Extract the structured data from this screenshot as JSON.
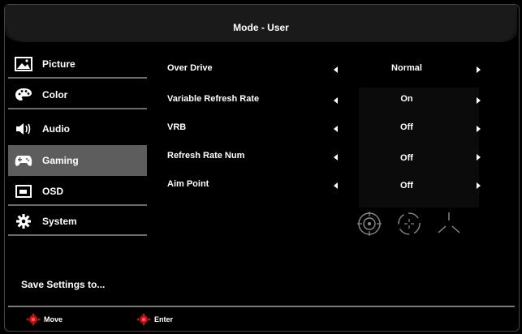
{
  "header": {
    "title": "Mode - User"
  },
  "sidebar": {
    "items": [
      {
        "label": "Picture",
        "icon": "picture-icon"
      },
      {
        "label": "Color",
        "icon": "palette-icon"
      },
      {
        "label": "Audio",
        "icon": "speaker-icon"
      },
      {
        "label": "Gaming",
        "icon": "gamepad-icon",
        "active": true
      },
      {
        "label": "OSD",
        "icon": "osd-window-icon"
      },
      {
        "label": "System",
        "icon": "gear-icon"
      }
    ],
    "save_label": "Save Settings to..."
  },
  "settings": [
    {
      "name": "Over Drive",
      "value": "Normal"
    },
    {
      "name": "Variable Refresh Rate",
      "value": "On"
    },
    {
      "name": "VRB",
      "value": "Off"
    },
    {
      "name": "Refresh Rate Num",
      "value": "Off"
    },
    {
      "name": "Aim Point",
      "value": "Off"
    }
  ],
  "aim_point_options": [
    "aim-point-circle-icon",
    "aim-point-dot-icon",
    "aim-point-tri-icon"
  ],
  "footer": {
    "move_label": "Move",
    "enter_label": "Enter"
  },
  "colors": {
    "accent": "#cc1111",
    "active_bg": "#5d5d5d"
  }
}
